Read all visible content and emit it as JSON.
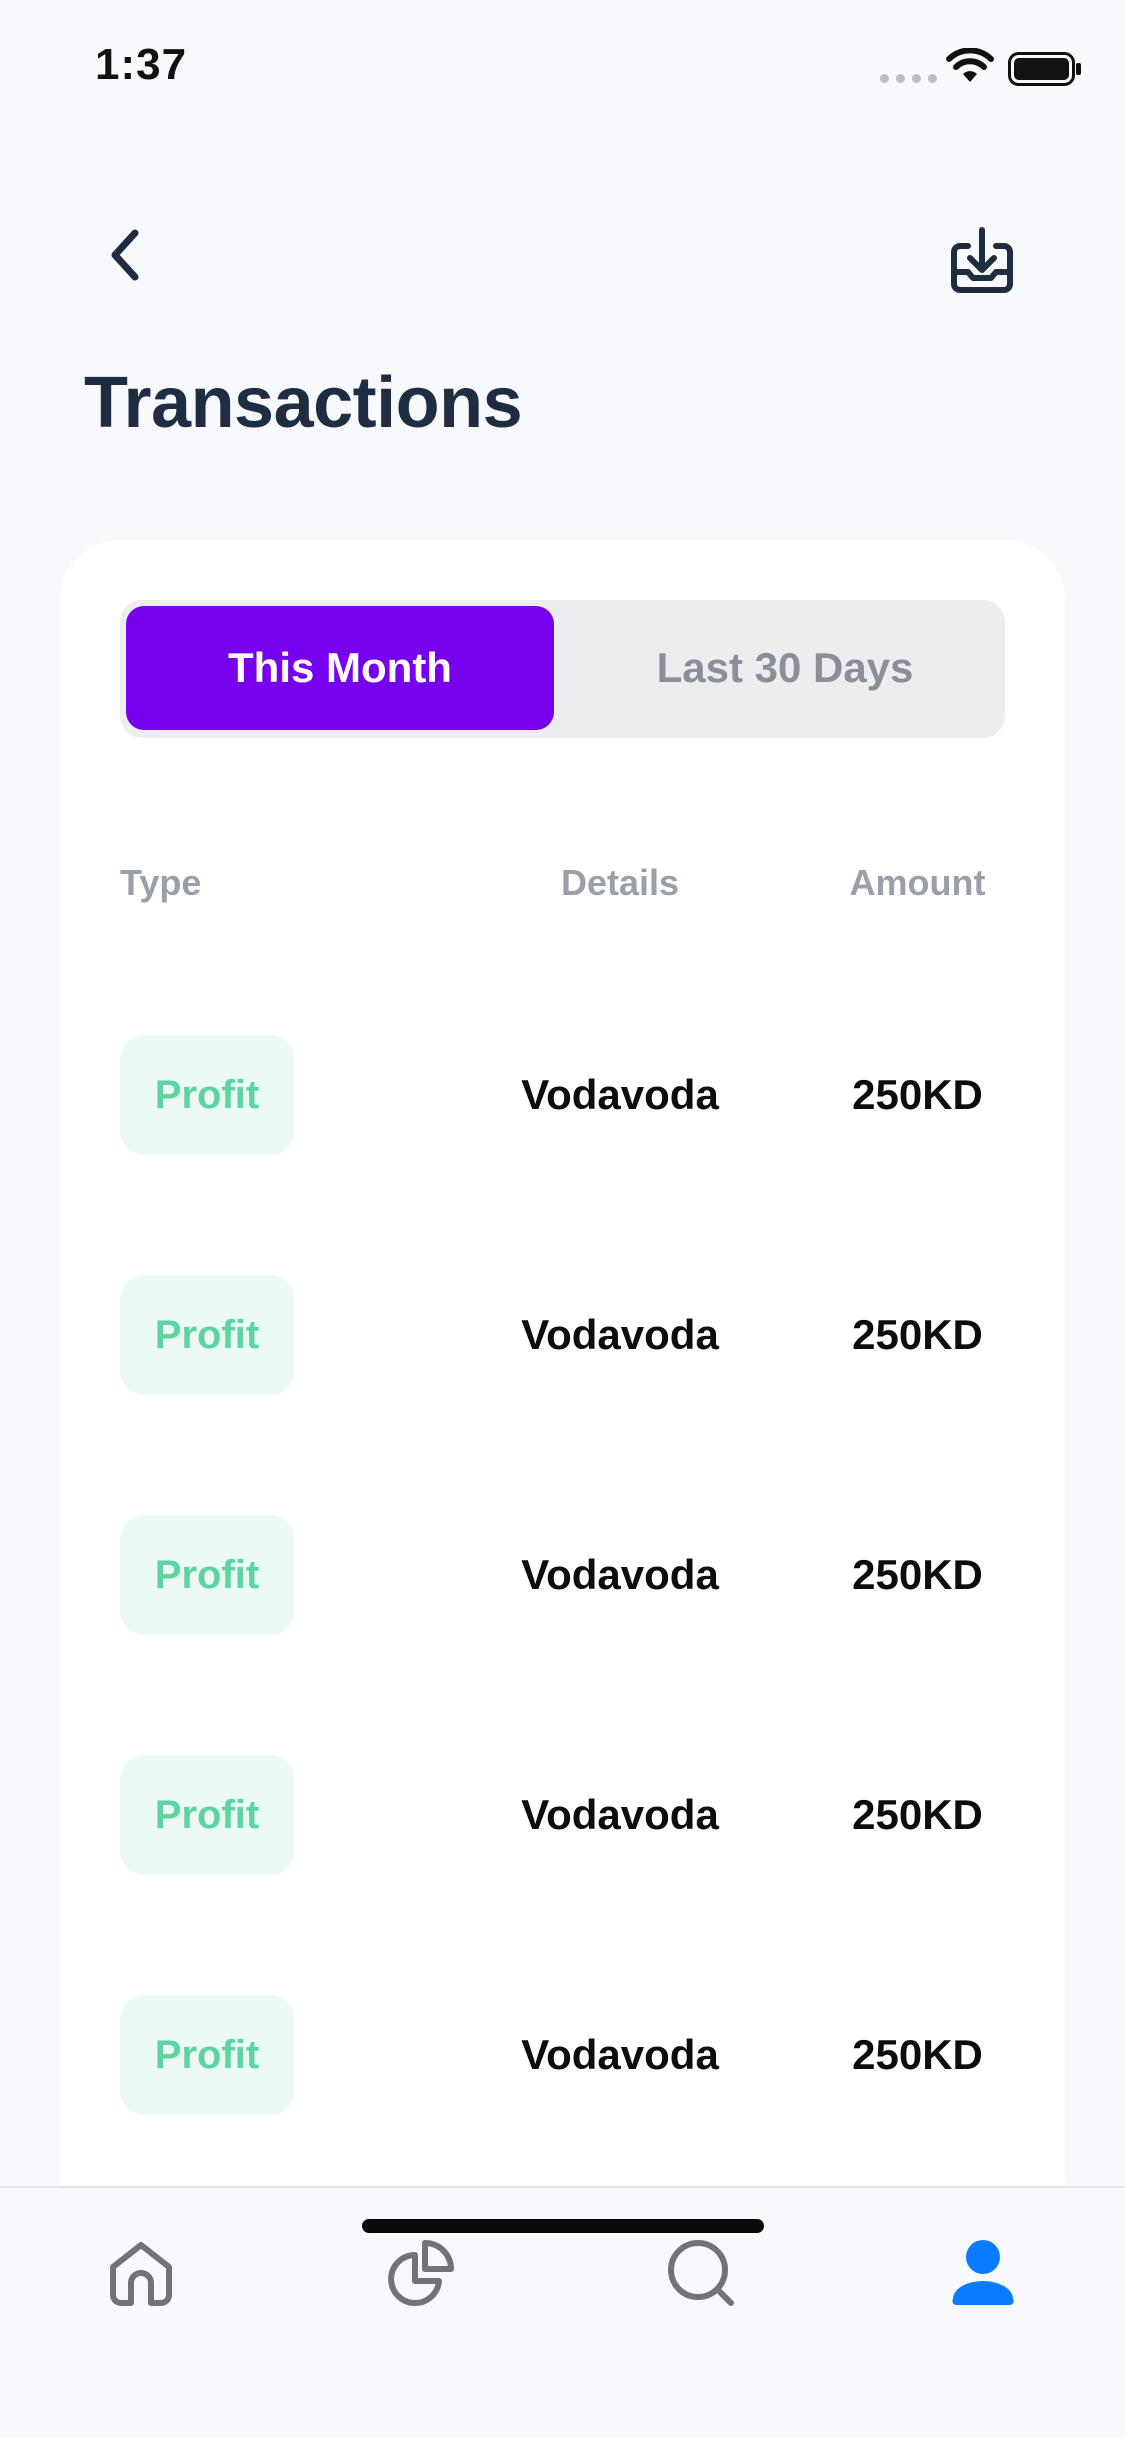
{
  "status_bar": {
    "time": "1:37"
  },
  "header": {
    "back_icon": "chevron-left-icon",
    "download_icon": "download-tray-icon",
    "title": "Transactions"
  },
  "segmented": {
    "options": [
      "This Month",
      "Last 30 Days"
    ],
    "selected": "This Month",
    "active_color": "#7700ee"
  },
  "table": {
    "columns": [
      "Type",
      "Details",
      "Amount"
    ],
    "rows": [
      {
        "type": "Profit",
        "details": "Vodavoda",
        "amount": "250KD"
      },
      {
        "type": "Profit",
        "details": "Vodavoda",
        "amount": "250KD"
      },
      {
        "type": "Profit",
        "details": "Vodavoda",
        "amount": "250KD"
      },
      {
        "type": "Profit",
        "details": "Vodavoda",
        "amount": "250KD"
      },
      {
        "type": "Profit",
        "details": "Vodavoda",
        "amount": "250KD"
      }
    ],
    "profit_color": "#5fd3a2",
    "profit_bg": "#ecfaf5"
  },
  "tab_bar": {
    "items": [
      {
        "icon": "home-icon",
        "active": false
      },
      {
        "icon": "pie-chart-icon",
        "active": false
      },
      {
        "icon": "search-icon",
        "active": false
      },
      {
        "icon": "profile-icon",
        "active": true
      }
    ],
    "active_color": "#0a7cff"
  }
}
